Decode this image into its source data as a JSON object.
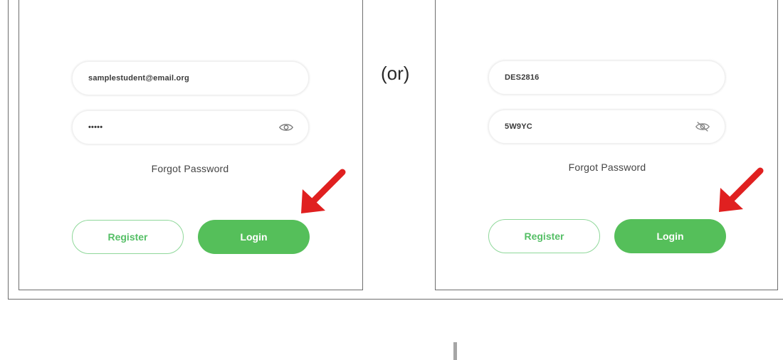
{
  "separator_text": "(or)",
  "left_form": {
    "email_value": "samplestudent@email.org",
    "password_value": "•••••",
    "forgot_label": "Forgot Password",
    "register_label": "Register",
    "login_label": "Login",
    "eye_icon": "eye-open-icon"
  },
  "right_form": {
    "username_value": "DES2816",
    "password_value": "5W9YC",
    "forgot_label": "Forgot Password",
    "register_label": "Register",
    "login_label": "Login",
    "eye_icon": "eye-slash-icon"
  },
  "colors": {
    "accent_green": "#55bf5a",
    "annotation_arrow": "#e02020"
  }
}
